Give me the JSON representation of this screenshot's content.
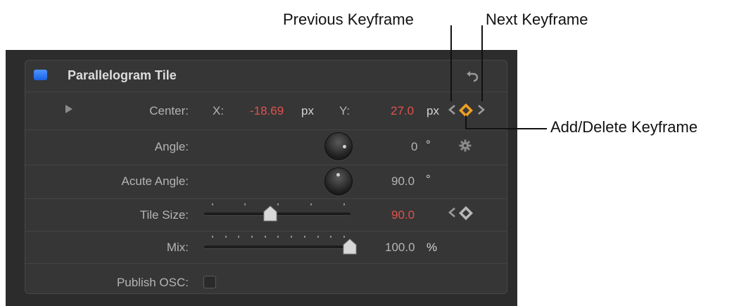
{
  "callouts": {
    "previous_keyframe": "Previous Keyframe",
    "next_keyframe": "Next Keyframe",
    "add_delete_keyframe": "Add/Delete Keyframe"
  },
  "header": {
    "title": "Parallelogram Tile"
  },
  "rows": {
    "center": {
      "label": "Center:",
      "x_label": "X:",
      "x_value": "-18.69",
      "x_unit": "px",
      "y_label": "Y:",
      "y_value": "27.0",
      "y_unit": "px"
    },
    "angle": {
      "label": "Angle:",
      "value": "0",
      "unit": "°"
    },
    "acute_angle": {
      "label": "Acute Angle:",
      "value": "90.0",
      "unit": "°"
    },
    "tile_size": {
      "label": "Tile Size:",
      "value": "90.0",
      "slider_fraction": 0.45
    },
    "mix": {
      "label": "Mix:",
      "value": "100.0",
      "unit": "%",
      "slider_fraction": 1.0
    },
    "publish_osc": {
      "label": "Publish OSC:",
      "checked": false
    }
  },
  "colors": {
    "panel_bg": "#2c2c2c",
    "group_bg": "#363636",
    "keyframed_value": "#e0524e",
    "keyframe_diamond": "#f0a020",
    "enable_checkbox": "#3a82ff"
  },
  "icons": [
    "reset-arrow-icon",
    "disclosure-triangle-icon",
    "gear-icon",
    "previous-keyframe-icon",
    "keyframe-diamond-icon",
    "next-keyframe-icon"
  ]
}
